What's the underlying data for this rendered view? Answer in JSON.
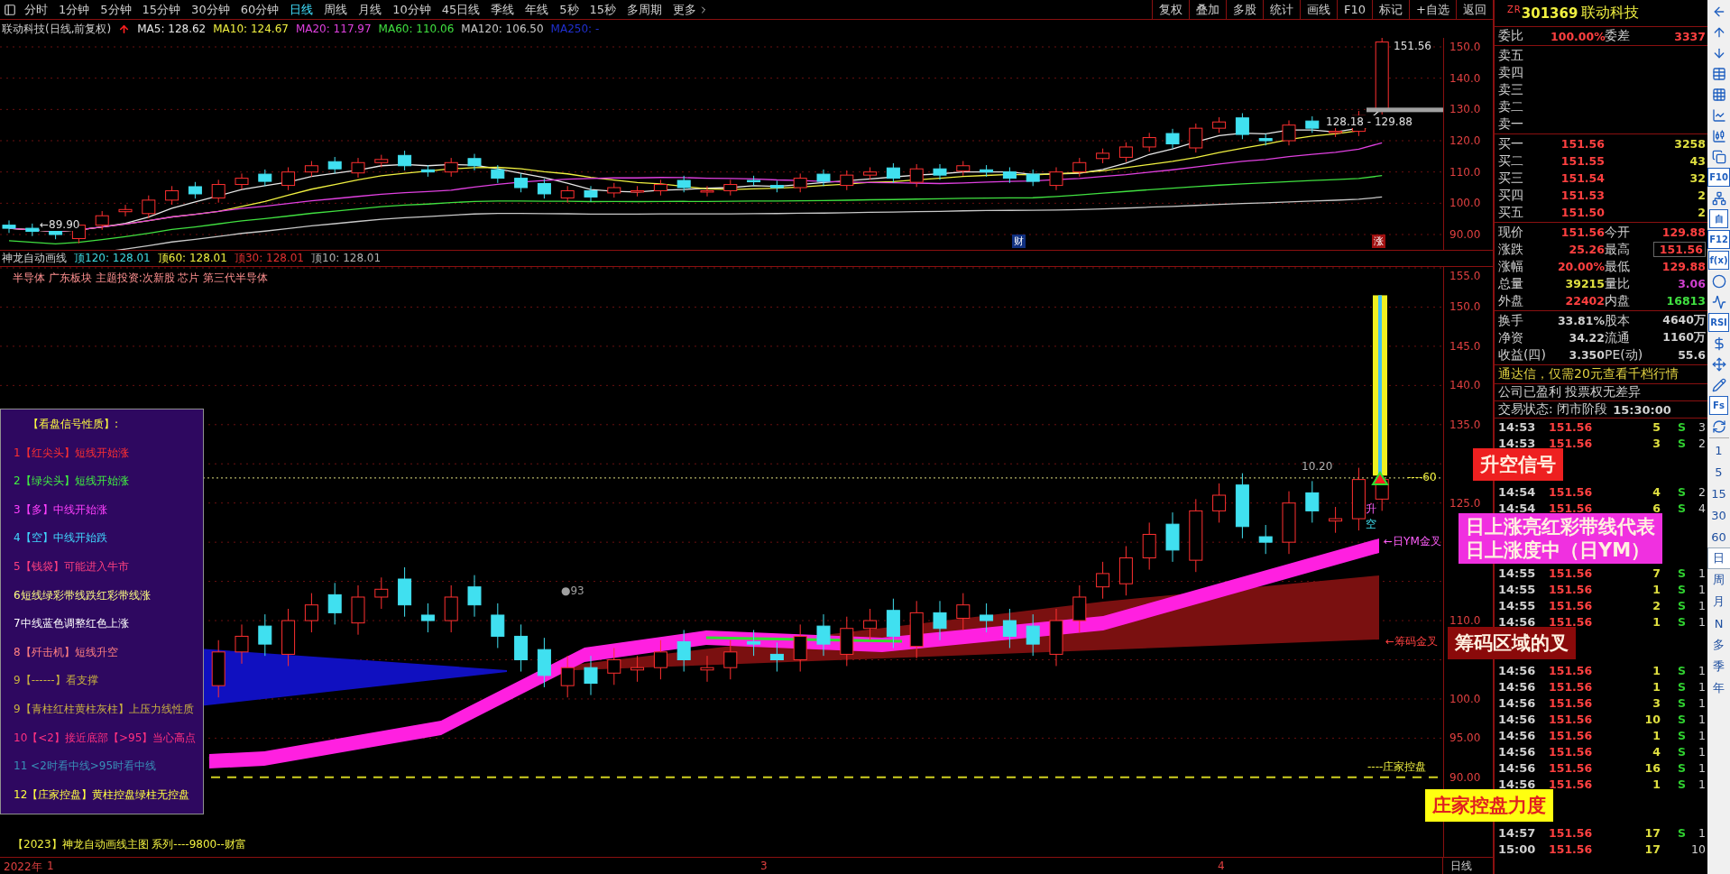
{
  "toolbar": {
    "periods": [
      {
        "label": "分时",
        "selected": false
      },
      {
        "label": "1分钟",
        "selected": false
      },
      {
        "label": "5分钟",
        "selected": false
      },
      {
        "label": "15分钟",
        "selected": false
      },
      {
        "label": "30分钟",
        "selected": false
      },
      {
        "label": "60分钟",
        "selected": false
      },
      {
        "label": "日线",
        "selected": true
      },
      {
        "label": "周线",
        "selected": false
      },
      {
        "label": "月线",
        "selected": false
      },
      {
        "label": "10分钟",
        "selected": false
      },
      {
        "label": "45日线",
        "selected": false
      },
      {
        "label": "季线",
        "selected": false
      },
      {
        "label": "年线",
        "selected": false
      },
      {
        "label": "5秒",
        "selected": false
      },
      {
        "label": "15秒",
        "selected": false
      },
      {
        "label": "多周期",
        "selected": false
      },
      {
        "label": "更多",
        "selected": false
      }
    ],
    "buttons": [
      "复权",
      "叠加",
      "多股",
      "统计",
      "画线",
      "F10",
      "标记",
      "+自选",
      "返回"
    ]
  },
  "ma_legend": {
    "title": "联动科技(日线,前复权)",
    "items": [
      {
        "label": "MA5: 128.62",
        "color": "#e8e8e8"
      },
      {
        "label": "MA10: 124.67",
        "color": "#f0f040"
      },
      {
        "label": "MA20: 117.97",
        "color": "#e040e0"
      },
      {
        "label": "MA60: 110.06",
        "color": "#40e040"
      },
      {
        "label": "MA120: 106.50",
        "color": "#c8c8c8"
      },
      {
        "label": "MA250: -",
        "color": "#2030d0"
      }
    ]
  },
  "upper_chart": {
    "axis": [
      "150.0",
      "140.0",
      "130.0",
      "120.0",
      "110.0",
      "100.0",
      "90.00"
    ],
    "annotations": [
      "151.56",
      "128.18 - 129.88",
      "←89.90"
    ],
    "markers": [
      "财",
      "涨"
    ]
  },
  "indicator": {
    "name": "神龙自动画线",
    "values": [
      {
        "label": "顶120: 128.01",
        "color": "#40d8e0"
      },
      {
        "label": "顶60: 128.01",
        "color": "#f0f040"
      },
      {
        "label": "顶30: 128.01",
        "color": "#e03030"
      },
      {
        "label": "顶10: 128.01",
        "color": "#b0b0b0"
      }
    ]
  },
  "lower_chart": {
    "sectors": "半导体 广东板块 主题投资:次新股 芯片 第三代半导体",
    "axis": [
      "155.0",
      "150.0",
      "145.0",
      "140.0",
      "135.0",
      "125.0",
      "110.0",
      "100.0",
      "95.00",
      "90.00"
    ],
    "legend": {
      "title": "【看盘信号性质】:",
      "items": [
        {
          "label": "1【红尖头】短线开始涨",
          "color": "#ff3030"
        },
        {
          "label": "2【绿尖头】短线开始涨",
          "color": "#40f040"
        },
        {
          "label": "3【多】中线开始涨",
          "color": "#ff40ff"
        },
        {
          "label": "4【空】中线开始跌",
          "color": "#40d8ff"
        },
        {
          "label": "5【钱袋】可能进入牛市",
          "color": "#ff4080"
        },
        {
          "label": "6短线绿彩带线跌红彩带线涨",
          "color": "#ffff80"
        },
        {
          "label": "7中线蓝色调整红色上涨",
          "color": "#ffffff"
        },
        {
          "label": "8【歼击机】短线升空",
          "color": "#ff8080"
        },
        {
          "label": "9【------】看支撑",
          "color": "#c8b040"
        },
        {
          "label": "9【青柱红柱黄柱灰柱】上压力线性质",
          "color": "#c8b041"
        },
        {
          "label": "10【<2】接近底部【>95】当心高点",
          "color": "#ff3080"
        },
        {
          "label": "11 <2时看中线>95时看中线",
          "color": "#3890b8"
        },
        {
          "label": "12【庄家控盘】黄柱控盘绿柱无控盘",
          "color": "#ffff40"
        }
      ]
    },
    "annotations": [
      "●93",
      "升",
      "空",
      "←日YM金叉",
      "←筹码金叉",
      "10.20",
      "----60",
      "----庄家控盘"
    ],
    "footer": "【2023】神龙自动画线主图 系列----9800--财富",
    "callouts": [
      {
        "kind": "red",
        "lines": [
          "升空信号"
        ]
      },
      {
        "kind": "magenta",
        "lines": [
          "日上涨亮红彩带线代表",
          "日上涨度中（日YM）"
        ]
      },
      {
        "kind": "maroon",
        "lines": [
          "筹码区域的叉"
        ]
      },
      {
        "kind": "yellow",
        "lines": [
          "庄家控盘力度"
        ]
      }
    ]
  },
  "date_axis": {
    "labels": [
      "2022年",
      "1",
      "3",
      "4"
    ],
    "period": "日线"
  },
  "quote": {
    "badge": "ZR",
    "code": "301369",
    "name": "联动科技",
    "ratio": {
      "label": "委比",
      "value": "100.00%",
      "label2": "委差",
      "value2": "3337"
    },
    "sells": [
      "卖五",
      "卖四",
      "卖三",
      "卖二",
      "卖一"
    ],
    "buys": [
      {
        "label": "买一",
        "price": "151.56",
        "volume": "3258"
      },
      {
        "label": "买二",
        "price": "151.55",
        "volume": "43"
      },
      {
        "label": "买三",
        "price": "151.54",
        "volume": "32"
      },
      {
        "label": "买四",
        "price": "151.53",
        "volume": "2"
      },
      {
        "label": "买五",
        "price": "151.50",
        "volume": "2"
      }
    ],
    "stats": [
      {
        "left": {
          "label": "现价",
          "value": "151.56",
          "color": "#ff4040"
        },
        "right": {
          "label": "今开",
          "value": "129.88",
          "color": "#ff4040",
          "boxed": false
        }
      },
      {
        "left": {
          "label": "涨跌",
          "value": "25.26",
          "color": "#ff4040"
        },
        "right": {
          "label": "最高",
          "value": "151.56",
          "color": "#ff4040",
          "boxed": true
        }
      },
      {
        "left": {
          "label": "涨幅",
          "value": "20.00%",
          "color": "#ff4040"
        },
        "right": {
          "label": "最低",
          "value": "129.88",
          "color": "#ff4040",
          "boxed": false
        }
      },
      {
        "left": {
          "label": "总量",
          "value": "39215",
          "color": "#e0e040"
        },
        "right": {
          "label": "量比",
          "value": "3.06",
          "color": "#d040d0",
          "boxed": false
        }
      },
      {
        "left": {
          "label": "外盘",
          "value": "22402",
          "color": "#ff4040"
        },
        "right": {
          "label": "内盘",
          "value": "16813",
          "color": "#40e040",
          "boxed": false
        }
      }
    ],
    "fundamentals": [
      {
        "label": "换手",
        "value": "33.81%",
        "label2": "股本",
        "value2": "4640万"
      },
      {
        "label": "净资",
        "value": "34.22",
        "label2": "流通",
        "value2": "1160万"
      },
      {
        "label": "收益(四)",
        "value": "3.350",
        "label2": "PE(动)",
        "value2": "55.6"
      }
    ],
    "promo": "通达信，仅需20元查看千档行情",
    "info": "公司已盈利 投票权无差异",
    "status": "交易状态: 闭市阶段",
    "status_time": "15:30:00",
    "ticks": [
      {
        "time": "14:53",
        "price": "151.56",
        "volume": "5",
        "side": "S",
        "count": "3"
      },
      {
        "time": "14:53",
        "price": "151.56",
        "volume": "3",
        "side": "S",
        "count": "2"
      },
      {
        "time": "14:54",
        "price": "151.56",
        "volume": "4",
        "side": "S",
        "count": "2"
      },
      {
        "time": "14:54",
        "price": "151.56",
        "volume": "6",
        "side": "S",
        "count": "4"
      },
      {
        "time": "14:55",
        "price": "151.56",
        "volume": "7",
        "side": "S",
        "count": "1"
      },
      {
        "time": "14:55",
        "price": "151.56",
        "volume": "1",
        "side": "S",
        "count": "1"
      },
      {
        "time": "14:55",
        "price": "151.56",
        "volume": "2",
        "side": "S",
        "count": "1"
      },
      {
        "time": "14:56",
        "price": "151.56",
        "volume": "1",
        "side": "S",
        "count": "1"
      },
      {
        "time": "14:56",
        "price": "151.56",
        "volume": "1",
        "side": "S",
        "count": "1"
      },
      {
        "time": "14:56",
        "price": "151.56",
        "volume": "1",
        "side": "S",
        "count": "1"
      },
      {
        "time": "14:56",
        "price": "151.56",
        "volume": "3",
        "side": "S",
        "count": "1"
      },
      {
        "time": "14:56",
        "price": "151.56",
        "volume": "10",
        "side": "S",
        "count": "1"
      },
      {
        "time": "14:56",
        "price": "151.56",
        "volume": "1",
        "side": "S",
        "count": "1"
      },
      {
        "time": "14:56",
        "price": "151.56",
        "volume": "4",
        "side": "S",
        "count": "1"
      },
      {
        "time": "14:56",
        "price": "151.56",
        "volume": "16",
        "side": "S",
        "count": "1"
      },
      {
        "time": "14:56",
        "price": "151.56",
        "volume": "1",
        "side": "S",
        "count": "1"
      },
      {
        "time": "14:57",
        "price": "151.56",
        "volume": "17",
        "side": "S",
        "count": "1"
      },
      {
        "time": "15:00",
        "price": "151.56",
        "volume": "17",
        "count": "10"
      }
    ]
  },
  "side_strip": {
    "text_tools": [
      "F10",
      "自",
      "F12",
      "f(x)",
      "RSI",
      "Fs"
    ],
    "periods": [
      {
        "label": "1",
        "selected": false
      },
      {
        "label": "5",
        "selected": false
      },
      {
        "label": "15",
        "selected": false
      },
      {
        "label": "30",
        "selected": false
      },
      {
        "label": "60",
        "selected": false
      },
      {
        "label": "日",
        "selected": true
      },
      {
        "label": "周",
        "selected": false
      },
      {
        "label": "月",
        "selected": false
      },
      {
        "label": "N",
        "selected": false
      },
      {
        "label": "多",
        "selected": false
      },
      {
        "label": "季",
        "selected": false
      },
      {
        "label": "年",
        "selected": false
      }
    ]
  }
}
